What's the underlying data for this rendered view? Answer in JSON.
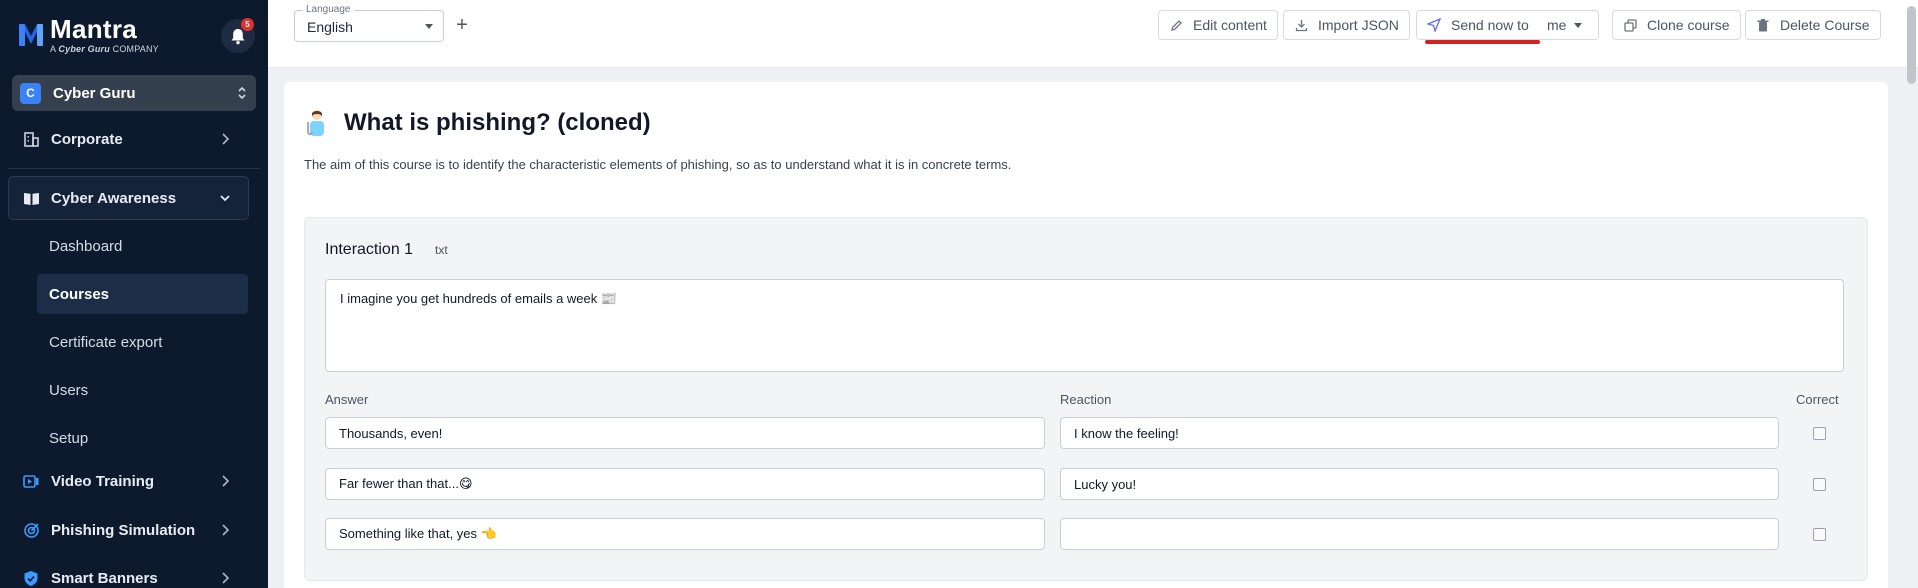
{
  "brand": {
    "name": "Mantra",
    "subtitle_prefix": "A",
    "subtitle_brand": "Cyber Guru",
    "subtitle_suffix": "COMPANY",
    "accent": "#3b82f6"
  },
  "notifications": {
    "count": "5"
  },
  "org": {
    "initial": "C",
    "name": "Cyber Guru"
  },
  "nav": {
    "corporate": "Corporate",
    "cyber_awareness": "Cyber Awareness",
    "sub": {
      "dashboard": "Dashboard",
      "courses": "Courses",
      "certificate_export": "Certificate export",
      "users": "Users",
      "setup": "Setup"
    },
    "video_training": "Video Training",
    "phishing_simulation": "Phishing Simulation",
    "smart_banners": "Smart Banners"
  },
  "toolbar": {
    "language_label": "Language",
    "language_value": "English",
    "add_label": "+",
    "edit_content": "Edit content",
    "import_json": "Import JSON",
    "send_now_to": "Send now to",
    "send_target": "me",
    "clone_course": "Clone course",
    "delete_course": "Delete Course"
  },
  "course": {
    "title": "What is phishing? (cloned)",
    "description": "The aim of this course is to identify the characteristic elements of phishing, so as to understand what it is in concrete terms."
  },
  "interaction": {
    "title": "Interaction 1",
    "type": "txt",
    "message": "I imagine you get hundreds of emails a week 📰",
    "columns": {
      "answer": "Answer",
      "reaction": "Reaction",
      "correct": "Correct"
    },
    "rows": [
      {
        "answer": "Thousands, even!",
        "reaction": "I know the feeling!",
        "correct": false
      },
      {
        "answer": "Far fewer than that...😋",
        "reaction": "Lucky you!",
        "correct": false
      },
      {
        "answer": "Something like that, yes 👈",
        "reaction": "",
        "correct": false
      }
    ]
  }
}
